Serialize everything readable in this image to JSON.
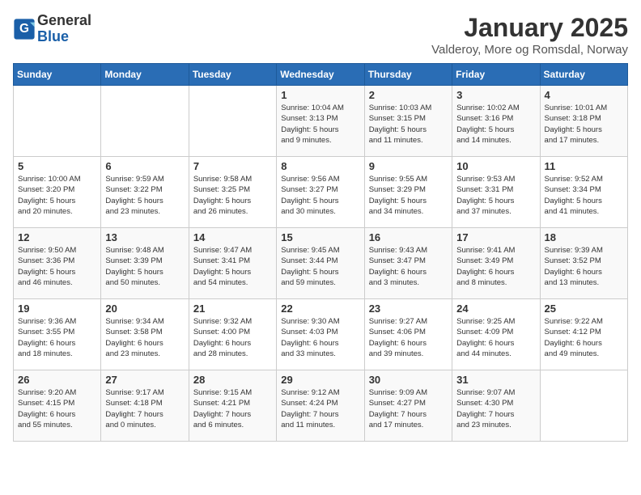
{
  "logo": {
    "general": "General",
    "blue": "Blue"
  },
  "title": "January 2025",
  "subtitle": "Valderoy, More og Romsdal, Norway",
  "headers": [
    "Sunday",
    "Monday",
    "Tuesday",
    "Wednesday",
    "Thursday",
    "Friday",
    "Saturday"
  ],
  "weeks": [
    [
      {
        "day": "",
        "info": ""
      },
      {
        "day": "",
        "info": ""
      },
      {
        "day": "",
        "info": ""
      },
      {
        "day": "1",
        "info": "Sunrise: 10:04 AM\nSunset: 3:13 PM\nDaylight: 5 hours\nand 9 minutes."
      },
      {
        "day": "2",
        "info": "Sunrise: 10:03 AM\nSunset: 3:15 PM\nDaylight: 5 hours\nand 11 minutes."
      },
      {
        "day": "3",
        "info": "Sunrise: 10:02 AM\nSunset: 3:16 PM\nDaylight: 5 hours\nand 14 minutes."
      },
      {
        "day": "4",
        "info": "Sunrise: 10:01 AM\nSunset: 3:18 PM\nDaylight: 5 hours\nand 17 minutes."
      }
    ],
    [
      {
        "day": "5",
        "info": "Sunrise: 10:00 AM\nSunset: 3:20 PM\nDaylight: 5 hours\nand 20 minutes."
      },
      {
        "day": "6",
        "info": "Sunrise: 9:59 AM\nSunset: 3:22 PM\nDaylight: 5 hours\nand 23 minutes."
      },
      {
        "day": "7",
        "info": "Sunrise: 9:58 AM\nSunset: 3:25 PM\nDaylight: 5 hours\nand 26 minutes."
      },
      {
        "day": "8",
        "info": "Sunrise: 9:56 AM\nSunset: 3:27 PM\nDaylight: 5 hours\nand 30 minutes."
      },
      {
        "day": "9",
        "info": "Sunrise: 9:55 AM\nSunset: 3:29 PM\nDaylight: 5 hours\nand 34 minutes."
      },
      {
        "day": "10",
        "info": "Sunrise: 9:53 AM\nSunset: 3:31 PM\nDaylight: 5 hours\nand 37 minutes."
      },
      {
        "day": "11",
        "info": "Sunrise: 9:52 AM\nSunset: 3:34 PM\nDaylight: 5 hours\nand 41 minutes."
      }
    ],
    [
      {
        "day": "12",
        "info": "Sunrise: 9:50 AM\nSunset: 3:36 PM\nDaylight: 5 hours\nand 46 minutes."
      },
      {
        "day": "13",
        "info": "Sunrise: 9:48 AM\nSunset: 3:39 PM\nDaylight: 5 hours\nand 50 minutes."
      },
      {
        "day": "14",
        "info": "Sunrise: 9:47 AM\nSunset: 3:41 PM\nDaylight: 5 hours\nand 54 minutes."
      },
      {
        "day": "15",
        "info": "Sunrise: 9:45 AM\nSunset: 3:44 PM\nDaylight: 5 hours\nand 59 minutes."
      },
      {
        "day": "16",
        "info": "Sunrise: 9:43 AM\nSunset: 3:47 PM\nDaylight: 6 hours\nand 3 minutes."
      },
      {
        "day": "17",
        "info": "Sunrise: 9:41 AM\nSunset: 3:49 PM\nDaylight: 6 hours\nand 8 minutes."
      },
      {
        "day": "18",
        "info": "Sunrise: 9:39 AM\nSunset: 3:52 PM\nDaylight: 6 hours\nand 13 minutes."
      }
    ],
    [
      {
        "day": "19",
        "info": "Sunrise: 9:36 AM\nSunset: 3:55 PM\nDaylight: 6 hours\nand 18 minutes."
      },
      {
        "day": "20",
        "info": "Sunrise: 9:34 AM\nSunset: 3:58 PM\nDaylight: 6 hours\nand 23 minutes."
      },
      {
        "day": "21",
        "info": "Sunrise: 9:32 AM\nSunset: 4:00 PM\nDaylight: 6 hours\nand 28 minutes."
      },
      {
        "day": "22",
        "info": "Sunrise: 9:30 AM\nSunset: 4:03 PM\nDaylight: 6 hours\nand 33 minutes."
      },
      {
        "day": "23",
        "info": "Sunrise: 9:27 AM\nSunset: 4:06 PM\nDaylight: 6 hours\nand 39 minutes."
      },
      {
        "day": "24",
        "info": "Sunrise: 9:25 AM\nSunset: 4:09 PM\nDaylight: 6 hours\nand 44 minutes."
      },
      {
        "day": "25",
        "info": "Sunrise: 9:22 AM\nSunset: 4:12 PM\nDaylight: 6 hours\nand 49 minutes."
      }
    ],
    [
      {
        "day": "26",
        "info": "Sunrise: 9:20 AM\nSunset: 4:15 PM\nDaylight: 6 hours\nand 55 minutes."
      },
      {
        "day": "27",
        "info": "Sunrise: 9:17 AM\nSunset: 4:18 PM\nDaylight: 7 hours\nand 0 minutes."
      },
      {
        "day": "28",
        "info": "Sunrise: 9:15 AM\nSunset: 4:21 PM\nDaylight: 7 hours\nand 6 minutes."
      },
      {
        "day": "29",
        "info": "Sunrise: 9:12 AM\nSunset: 4:24 PM\nDaylight: 7 hours\nand 11 minutes."
      },
      {
        "day": "30",
        "info": "Sunrise: 9:09 AM\nSunset: 4:27 PM\nDaylight: 7 hours\nand 17 minutes."
      },
      {
        "day": "31",
        "info": "Sunrise: 9:07 AM\nSunset: 4:30 PM\nDaylight: 7 hours\nand 23 minutes."
      },
      {
        "day": "",
        "info": ""
      }
    ]
  ]
}
